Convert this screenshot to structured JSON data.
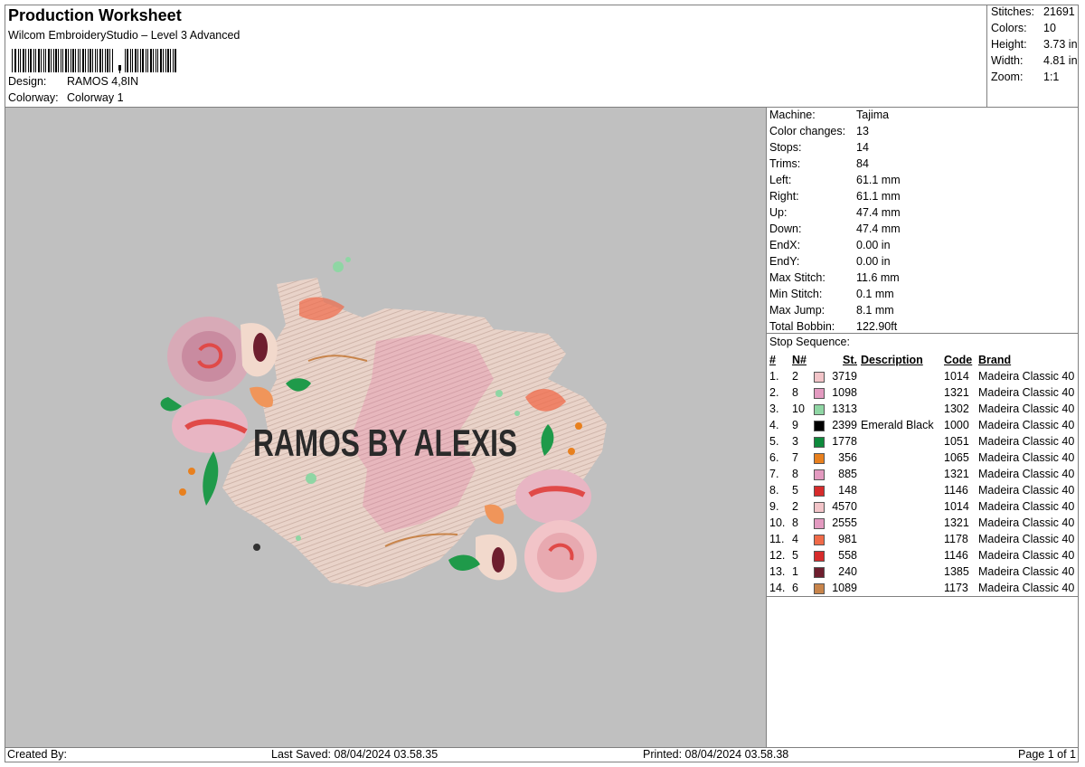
{
  "header": {
    "title": "Production Worksheet",
    "subtitle": "Wilcom EmbroideryStudio – Level 3 Advanced",
    "design_label": "Design:",
    "design_value": "RAMOS 4,8IN",
    "colorway_label": "Colorway:",
    "colorway_value": "Colorway 1"
  },
  "stats": [
    {
      "label": "Stitches:",
      "value": "21691"
    },
    {
      "label": "Colors:",
      "value": "10"
    },
    {
      "label": "Height:",
      "value": "3.73 in"
    },
    {
      "label": "Width:",
      "value": "4.81 in"
    },
    {
      "label": "Zoom:",
      "value": "1:1"
    }
  ],
  "machine_info": [
    {
      "label": "Machine:",
      "value": "Tajima"
    },
    {
      "label": "Color changes:",
      "value": "13"
    },
    {
      "label": "Stops:",
      "value": "14"
    },
    {
      "label": "Trims:",
      "value": "84"
    },
    {
      "label": "Left:",
      "value": "61.1 mm"
    },
    {
      "label": "Right:",
      "value": "61.1 mm"
    },
    {
      "label": "Up:",
      "value": "47.4 mm"
    },
    {
      "label": "Down:",
      "value": "47.4 mm"
    },
    {
      "label": "EndX:",
      "value": "0.00 in"
    },
    {
      "label": "EndY:",
      "value": "0.00 in"
    },
    {
      "label": "Max Stitch:",
      "value": "11.6 mm"
    },
    {
      "label": "Min Stitch:",
      "value": "0.1 mm"
    },
    {
      "label": "Max Jump:",
      "value": "8.1 mm"
    },
    {
      "label": "Total Bobbin:",
      "value": "122.90ft"
    }
  ],
  "stop_sequence": {
    "label": "Stop Sequence:",
    "headers": {
      "num": "#",
      "n": "N#",
      "st": "St.",
      "desc": "Description",
      "code": "Code",
      "brand": "Brand"
    },
    "rows": [
      {
        "num": "1.",
        "n": "2",
        "color": "#f2c4c8",
        "st": "3719",
        "desc": "",
        "code": "1014",
        "brand": "Madeira Classic 40"
      },
      {
        "num": "2.",
        "n": "8",
        "color": "#e39ac0",
        "st": "1098",
        "desc": "",
        "code": "1321",
        "brand": "Madeira Classic 40"
      },
      {
        "num": "3.",
        "n": "10",
        "color": "#8fd6a4",
        "st": "1313",
        "desc": "",
        "code": "1302",
        "brand": "Madeira Classic 40"
      },
      {
        "num": "4.",
        "n": "9",
        "color": "#000000",
        "st": "2399",
        "desc": "Emerald Black",
        "code": "1000",
        "brand": "Madeira Classic 40"
      },
      {
        "num": "5.",
        "n": "3",
        "color": "#0e8a3c",
        "st": "1778",
        "desc": "",
        "code": "1051",
        "brand": "Madeira Classic 40"
      },
      {
        "num": "6.",
        "n": "7",
        "color": "#e8801e",
        "st": "356",
        "desc": "",
        "code": "1065",
        "brand": "Madeira Classic 40"
      },
      {
        "num": "7.",
        "n": "8",
        "color": "#e39ac0",
        "st": "885",
        "desc": "",
        "code": "1321",
        "brand": "Madeira Classic 40"
      },
      {
        "num": "8.",
        "n": "5",
        "color": "#d62b2b",
        "st": "148",
        "desc": "",
        "code": "1146",
        "brand": "Madeira Classic 40"
      },
      {
        "num": "9.",
        "n": "2",
        "color": "#f2c4c8",
        "st": "4570",
        "desc": "",
        "code": "1014",
        "brand": "Madeira Classic 40"
      },
      {
        "num": "10.",
        "n": "8",
        "color": "#e39ac0",
        "st": "2555",
        "desc": "",
        "code": "1321",
        "brand": "Madeira Classic 40"
      },
      {
        "num": "11.",
        "n": "4",
        "color": "#f06a48",
        "st": "981",
        "desc": "",
        "code": "1178",
        "brand": "Madeira Classic 40"
      },
      {
        "num": "12.",
        "n": "5",
        "color": "#d62b2b",
        "st": "558",
        "desc": "",
        "code": "1146",
        "brand": "Madeira Classic 40"
      },
      {
        "num": "13.",
        "n": "1",
        "color": "#6e1e2e",
        "st": "240",
        "desc": "",
        "code": "1385",
        "brand": "Madeira Classic 40"
      },
      {
        "num": "14.",
        "n": "6",
        "color": "#c8844a",
        "st": "1089",
        "desc": "",
        "code": "1173",
        "brand": "Madeira Classic 40"
      }
    ]
  },
  "design_preview": {
    "text": "RAMOS BY ALEXIS"
  },
  "footer": {
    "created_by": "Created By:",
    "last_saved": "Last Saved: 08/04/2024 03.58.35",
    "printed": "Printed: 08/04/2024 03.58.38",
    "page": "Page 1 of 1"
  }
}
